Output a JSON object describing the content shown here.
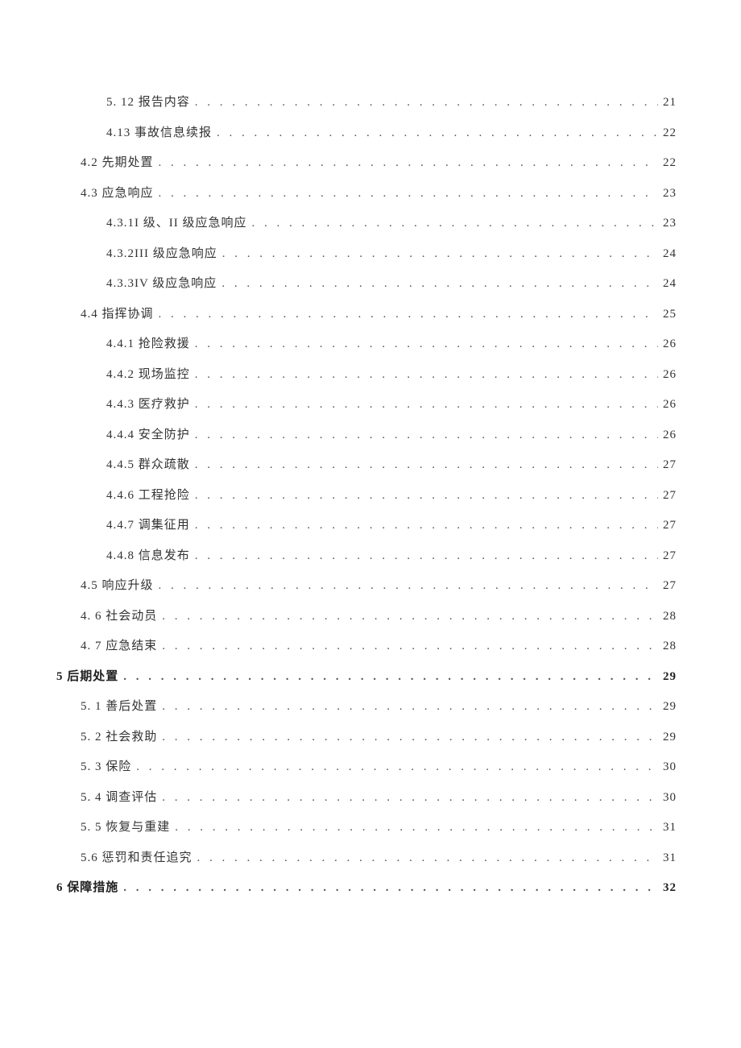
{
  "toc": [
    {
      "label": "5.  12 报告内容",
      "page": "21",
      "indent": 2,
      "bold": false
    },
    {
      "label": "4.13 事故信息续报",
      "page": "22",
      "indent": 2,
      "bold": false
    },
    {
      "label": "4.2 先期处置",
      "page": "22",
      "indent": 1,
      "bold": false
    },
    {
      "label": "4.3 应急响应",
      "page": "23",
      "indent": 1,
      "bold": false
    },
    {
      "label": "4.3.1I 级、II 级应急响应",
      "page": "23",
      "indent": 2,
      "bold": false
    },
    {
      "label": "4.3.2III 级应急响应",
      "page": "24",
      "indent": 2,
      "bold": false
    },
    {
      "label": "4.3.3IV 级应急响应",
      "page": "24",
      "indent": 2,
      "bold": false
    },
    {
      "label": "4.4 指挥协调",
      "page": "25",
      "indent": 1,
      "bold": false
    },
    {
      "label": "4.4.1 抢险救援",
      "page": "26",
      "indent": 2,
      "bold": false
    },
    {
      "label": "4.4.2 现场监控",
      "page": "26",
      "indent": 2,
      "bold": false
    },
    {
      "label": "4.4.3 医疗救护",
      "page": "26",
      "indent": 2,
      "bold": false
    },
    {
      "label": "4.4.4 安全防护",
      "page": "26",
      "indent": 2,
      "bold": false
    },
    {
      "label": "4.4.5 群众疏散",
      "page": "27",
      "indent": 2,
      "bold": false
    },
    {
      "label": "4.4.6 工程抢险",
      "page": "27",
      "indent": 2,
      "bold": false
    },
    {
      "label": "4.4.7 调集征用",
      "page": "27",
      "indent": 2,
      "bold": false
    },
    {
      "label": "4.4.8 信息发布",
      "page": "27",
      "indent": 2,
      "bold": false
    },
    {
      "label": "4.5 响应升级",
      "page": "27",
      "indent": 1,
      "bold": false
    },
    {
      "label": "4.  6 社会动员",
      "page": "28",
      "indent": 1,
      "bold": false
    },
    {
      "label": "4.  7 应急结束",
      "page": "28",
      "indent": 1,
      "bold": false
    },
    {
      "label": "5 后期处置",
      "page": "29",
      "indent": 0,
      "bold": true
    },
    {
      "label": "5.  1 善后处置",
      "page": "29",
      "indent": 1,
      "bold": false
    },
    {
      "label": "5.  2 社会救助",
      "page": "29",
      "indent": 1,
      "bold": false
    },
    {
      "label": "5.  3 保险",
      "page": "30",
      "indent": 1,
      "bold": false
    },
    {
      "label": "5.  4 调查评估",
      "page": "30",
      "indent": 1,
      "bold": false
    },
    {
      "label": "5.  5 恢复与重建",
      "page": "31",
      "indent": 1,
      "bold": false
    },
    {
      "label": "5.6 惩罚和责任追究",
      "page": "31",
      "indent": 1,
      "bold": false
    },
    {
      "label": "6 保障措施",
      "page": "32",
      "indent": 0,
      "bold": true
    }
  ]
}
